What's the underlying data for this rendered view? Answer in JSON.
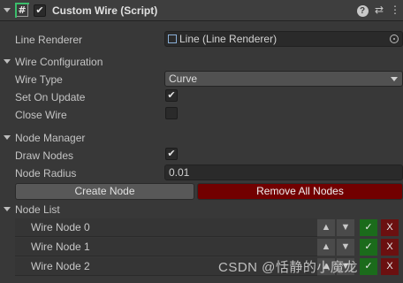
{
  "header": {
    "title": "Custom Wire (Script)",
    "script_icon_glyph": "#",
    "enabled_check": "✔",
    "help_glyph": "?",
    "presets_glyph": "⇄",
    "menu_glyph": "⋮"
  },
  "line_renderer": {
    "label": "Line Renderer",
    "value": "Line (Line Renderer)",
    "icon": "line-renderer-icon",
    "picker_icon": "object-picker-icon"
  },
  "wire_configuration": {
    "title": "Wire Configuration",
    "wire_type_label": "Wire Type",
    "wire_type_value": "Curve",
    "set_on_update_label": "Set On Update",
    "set_on_update_checked": true,
    "close_wire_label": "Close Wire",
    "close_wire_checked": false
  },
  "node_manager": {
    "title": "Node Manager",
    "draw_nodes_label": "Draw Nodes",
    "draw_nodes_checked": true,
    "node_radius_label": "Node Radius",
    "node_radius_value": "0.01",
    "create_button": "Create Node",
    "remove_button": "Remove All Nodes"
  },
  "node_list": {
    "title": "Node List",
    "nodes": [
      {
        "label": "Wire Node 0"
      },
      {
        "label": "Wire Node 1"
      },
      {
        "label": "Wire Node 2"
      }
    ],
    "up_glyph": "▲",
    "down_glyph": "▼",
    "select_glyph": "✓",
    "remove_glyph": "X"
  },
  "check_glyph": "✔",
  "watermark": "CSDN @恬静的小魔龙",
  "colors": {
    "background": "#383838",
    "remove_button": "#720000",
    "select_button": "#1b6b1b",
    "delete_button": "#6b1010"
  }
}
